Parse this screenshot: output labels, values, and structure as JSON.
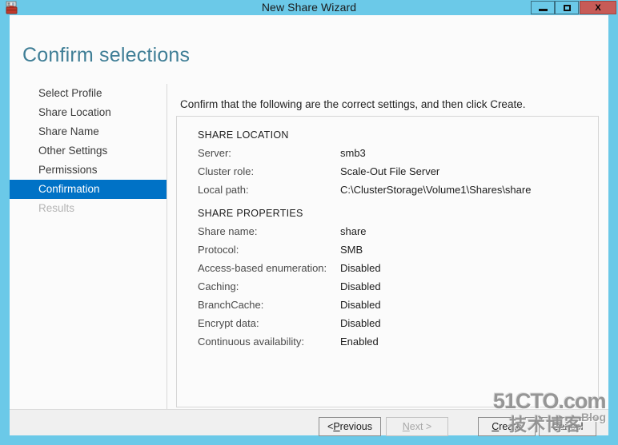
{
  "window": {
    "title": "New Share Wizard",
    "icon": "server-share-icon",
    "controls": {
      "minimize": "minimize-icon",
      "maximize": "maximize-icon",
      "close": "X"
    },
    "colors": {
      "title_bar": "#6BC9E8",
      "close_button": "#C75B57",
      "selection": "#0072C6",
      "heading": "#3F7E96",
      "client": "#FBFBFB",
      "footer": "#F0F0F0"
    }
  },
  "page": {
    "heading": "Confirm selections",
    "intro": "Confirm that the following are the correct settings, and then click Create."
  },
  "sidebar": {
    "items": [
      {
        "label": "Select Profile",
        "state": "normal"
      },
      {
        "label": "Share Location",
        "state": "normal"
      },
      {
        "label": "Share Name",
        "state": "normal"
      },
      {
        "label": "Other Settings",
        "state": "normal"
      },
      {
        "label": "Permissions",
        "state": "normal"
      },
      {
        "label": "Confirmation",
        "state": "selected"
      },
      {
        "label": "Results",
        "state": "disabled"
      }
    ]
  },
  "summary": {
    "sections": [
      {
        "title": "SHARE LOCATION",
        "rows": [
          {
            "label": "Server:",
            "value": "smb3"
          },
          {
            "label": "Cluster role:",
            "value": "Scale-Out File Server"
          },
          {
            "label": "Local path:",
            "value": "C:\\ClusterStorage\\Volume1\\Shares\\share"
          }
        ]
      },
      {
        "title": "SHARE PROPERTIES",
        "rows": [
          {
            "label": "Share name:",
            "value": "share"
          },
          {
            "label": "Protocol:",
            "value": "SMB"
          },
          {
            "label": "Access-based enumeration:",
            "value": "Disabled"
          },
          {
            "label": "Caching:",
            "value": "Disabled"
          },
          {
            "label": "BranchCache:",
            "value": "Disabled"
          },
          {
            "label": "Encrypt data:",
            "value": "Disabled"
          },
          {
            "label": "Continuous availability:",
            "value": "Enabled"
          }
        ]
      }
    ]
  },
  "footer": {
    "previous": {
      "pre": "< ",
      "acc": "P",
      "post": "revious",
      "state": "enabled"
    },
    "next": {
      "pre": "",
      "acc": "N",
      "post": "ext >",
      "state": "disabled"
    },
    "create": {
      "pre": "",
      "acc": "C",
      "post": "reate",
      "state": "enabled"
    },
    "cancel": {
      "pre": "",
      "acc": "",
      "post": "Cancel",
      "state": "enabled"
    }
  },
  "watermark": {
    "main": "51CTO.com",
    "chinese": "技术博客",
    "blog": "Blog"
  }
}
